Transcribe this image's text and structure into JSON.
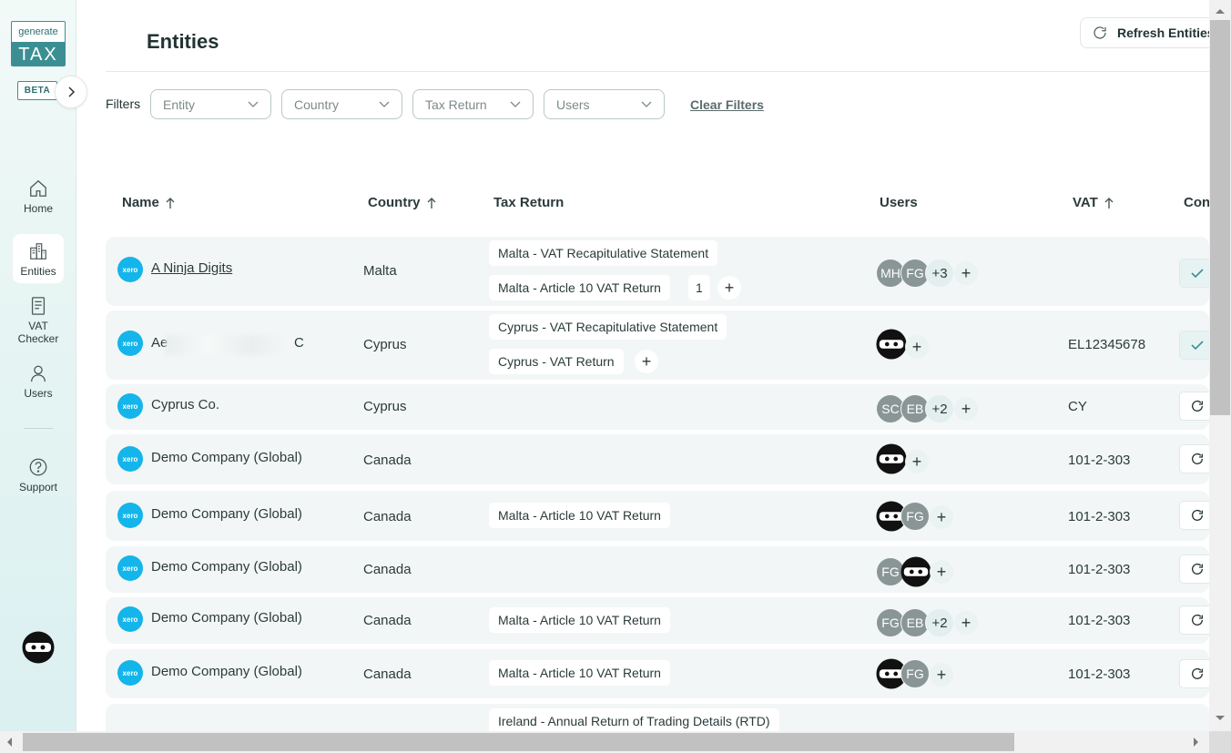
{
  "app": {
    "logo_top": "generate",
    "logo_bottom": "TAX",
    "beta": "BETA"
  },
  "nav": {
    "home": "Home",
    "entities": "Entities",
    "vat_checker_1": "VAT",
    "vat_checker_2": "Checker",
    "users": "Users",
    "support": "Support"
  },
  "header": {
    "title": "Entities",
    "refresh": "Refresh Entities"
  },
  "filters": {
    "label": "Filters",
    "entity": "Entity",
    "country": "Country",
    "tax_return": "Tax Return",
    "users": "Users",
    "clear": "Clear Filters"
  },
  "columns": {
    "name": "Name",
    "country": "Country",
    "tax_return": "Tax Return",
    "users": "Users",
    "vat": "VAT",
    "con": "Con"
  },
  "rows": [
    {
      "name": "A Ninja Digits",
      "country": "Malta",
      "returns": [
        "Malta - VAT Recapitulative Statement",
        "Malta - Article 10 VAT Return"
      ],
      "return_count": "1",
      "users": [
        "MH",
        "FG"
      ],
      "users_more": "+3",
      "vat": ""
    },
    {
      "name_start": "Ae",
      "name_end": "C",
      "country": "Cyprus",
      "returns": [
        "Cyprus - VAT Recapitulative Statement",
        "Cyprus - VAT Return"
      ],
      "vat": "EL12345678"
    },
    {
      "name": "Cyprus Co.",
      "country": "Cyprus",
      "users": [
        "SC",
        "EB"
      ],
      "users_more": "+2",
      "vat": "CY"
    },
    {
      "name": "Demo Company (Global)",
      "country": "Canada",
      "vat": "101-2-303"
    },
    {
      "name": "Demo Company (Global)",
      "country": "Canada",
      "returns": [
        "Malta - Article 10 VAT Return"
      ],
      "users": [
        "FG"
      ],
      "vat": "101-2-303"
    },
    {
      "name": "Demo Company (Global)",
      "country": "Canada",
      "users": [
        "FG"
      ],
      "vat": "101-2-303"
    },
    {
      "name": "Demo Company (Global)",
      "country": "Canada",
      "returns": [
        "Malta - Article 10 VAT Return"
      ],
      "users": [
        "FG",
        "EB"
      ],
      "users_more": "+2",
      "vat": "101-2-303"
    },
    {
      "name": "Demo Company (Global)",
      "country": "Canada",
      "returns": [
        "Malta - Article 10 VAT Return"
      ],
      "users": [
        "FG"
      ],
      "vat": "101-2-303"
    },
    {
      "returns": [
        "Ireland - Annual Return of Trading Details (RTD)"
      ]
    }
  ],
  "xero_label": "xero",
  "colors": {
    "accent": "#3b8f93",
    "xero": "#13b5ea",
    "row_bg": "#f3f6f6"
  }
}
